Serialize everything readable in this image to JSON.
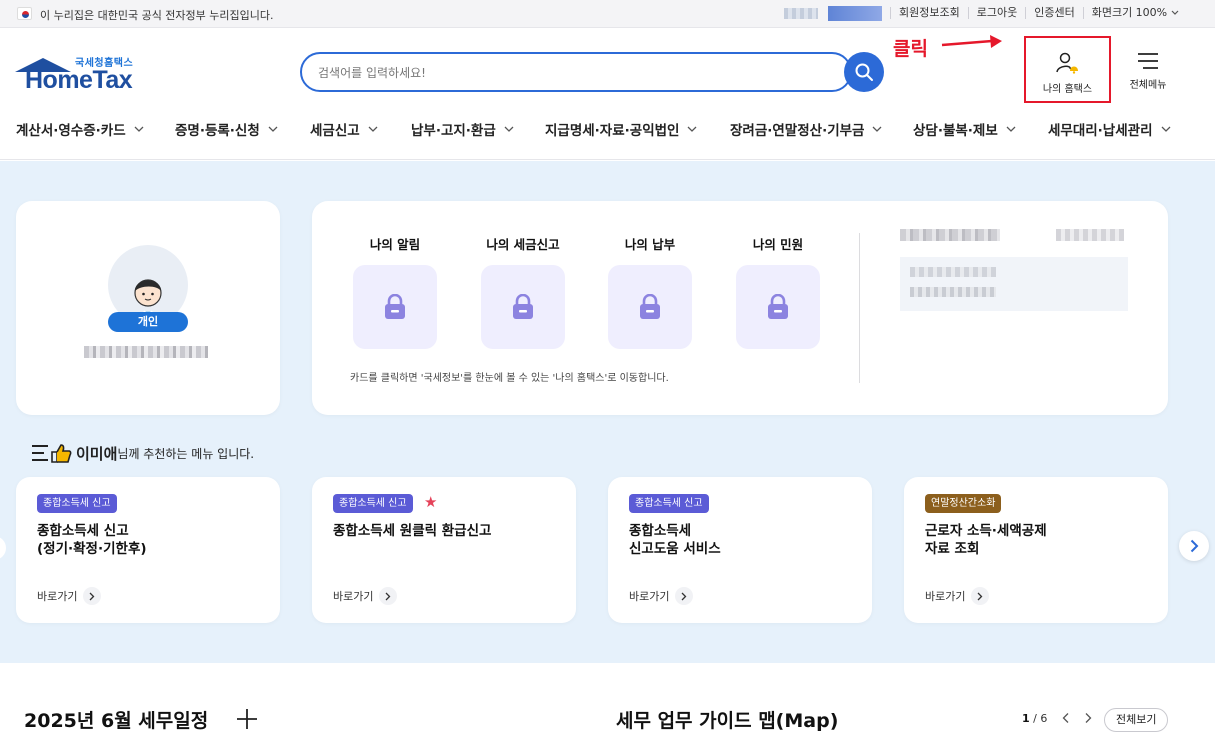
{
  "topbar": {
    "gov_notice": "이 누리집은 대한민국 공식 전자정부 누리집입니다.",
    "links": [
      "회원정보조회",
      "로그아웃",
      "인증센터",
      "화면크기 100%"
    ]
  },
  "header": {
    "logo_small": "국세청홈택스",
    "logo_big": "HomeTax",
    "search_placeholder": "검색어를 입력하세요!",
    "annotation": "클릭",
    "my_hometax_label": "나의 홈택스",
    "all_menu_label": "전체메뉴"
  },
  "nav": {
    "items": [
      "계산서·영수증·카드",
      "증명·등록·신청",
      "세금신고",
      "납부·고지·환급",
      "지급명세·자료·공익법인",
      "장려금·연말정산·기부금",
      "상담·불복·제보",
      "세무대리·납세관리"
    ]
  },
  "profile": {
    "badge": "개인"
  },
  "info": {
    "tiles": [
      "나의 알림",
      "나의 세금신고",
      "나의 납부",
      "나의 민원"
    ],
    "note": "카드를 클릭하면 '국세정보'를 한눈에 볼 수 있는 '나의 홈택스'로 이동합니다."
  },
  "recommend": {
    "user_name": "이미애",
    "suffix": "님께 추천하는 메뉴 입니다.",
    "go_label": "바로가기",
    "cards": [
      {
        "tag": "종합소득세 신고",
        "title": "종합소득세 신고\n(정기·확정·기한후)"
      },
      {
        "tag": "종합소득세 신고",
        "title": "종합소득세 원클릭 환급신고"
      },
      {
        "tag": "종합소득세 신고",
        "title": "종합소득세\n신고도움 서비스"
      },
      {
        "tag": "연말정산간소화",
        "title": "근로자 소득·세액공제\n자료 조회"
      }
    ]
  },
  "bottom": {
    "schedule_title": "2025년 6월 세무일정",
    "guide_title": "세무 업무 가이드 맵(Map)",
    "page_current": "1",
    "page_total": "/ 6",
    "view_all": "전체보기"
  },
  "colors": {
    "brand_blue": "#2c6ad7",
    "section_bg": "#e6f1fb",
    "tag_purple": "#5b5bd6",
    "tag_brown": "#8c5f1d",
    "annotation_red": "#e5182b"
  }
}
